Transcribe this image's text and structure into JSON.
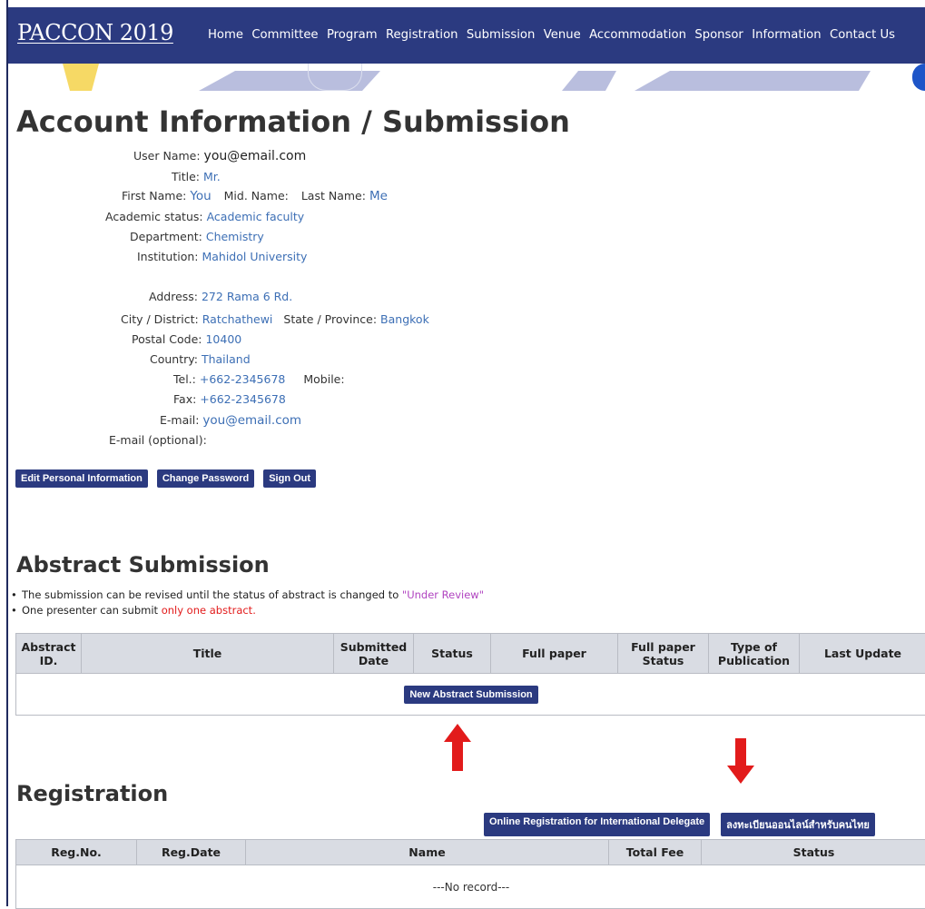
{
  "nav": {
    "logo": "PACCON 2019",
    "items": [
      "Home",
      "Committee",
      "Program",
      "Registration",
      "Submission",
      "Venue",
      "Accommodation",
      "Sponsor",
      "Information",
      "Contact Us"
    ]
  },
  "page_title": "Account Information / Submission",
  "account": {
    "username_label": "User Name:",
    "username": "you@email.com",
    "title_label": "Title:",
    "title": "Mr.",
    "first_name_label": "First Name:",
    "first_name": "You",
    "mid_name_label": "Mid. Name:",
    "last_name_label": "Last Name:",
    "last_name": "Me",
    "academic_label": "Academic status:",
    "academic": "Academic faculty",
    "department_label": "Department:",
    "department": "Chemistry",
    "institution_label": "Institution:",
    "institution": "Mahidol University",
    "address_label": "Address:",
    "address": "272 Rama 6 Rd.",
    "city_label": "City / District:",
    "city": "Ratchathewi",
    "state_label": "State / Province:",
    "state": "Bangkok",
    "postal_label": "Postal Code:",
    "postal": "10400",
    "country_label": "Country:",
    "country": "Thailand",
    "tel_label": "Tel.:",
    "tel": "+662-2345678",
    "mobile_label": "Mobile:",
    "fax_label": "Fax:",
    "fax": "+662-2345678",
    "email_label": "E-mail:",
    "email": "you@email.com",
    "email_opt_label": "E-mail (optional):"
  },
  "buttons": {
    "edit": "Edit Personal Information",
    "change_password": "Change Password",
    "sign_out": "Sign Out",
    "new_abstract": "New Abstract Submission",
    "reg_international": "Online Registration for International Delegate",
    "reg_thai": "ลงทะเบียนออนไลน์สำหรับคนไทย"
  },
  "abstract": {
    "heading": "Abstract Submission",
    "note1_pre": "The submission can be revised until the status of abstract is changed to ",
    "note1_hl": "\"Under Review\"",
    "note2_pre": "One presenter can submit ",
    "note2_hl": "only one abstract.",
    "columns": [
      "Abstract ID.",
      "Title",
      "Submitted Date",
      "Status",
      "Full paper",
      "Full paper Status",
      "Type of Publication",
      "Last Update"
    ]
  },
  "registration": {
    "heading": "Registration",
    "columns": [
      "Reg.No.",
      "Reg.Date",
      "Name",
      "Total Fee",
      "Status"
    ],
    "empty": "---No record---"
  },
  "colors": {
    "nav": "#2b3a80",
    "button": "#2b3a80",
    "link": "#3d6fb5",
    "arrow": "#e21b1b"
  }
}
